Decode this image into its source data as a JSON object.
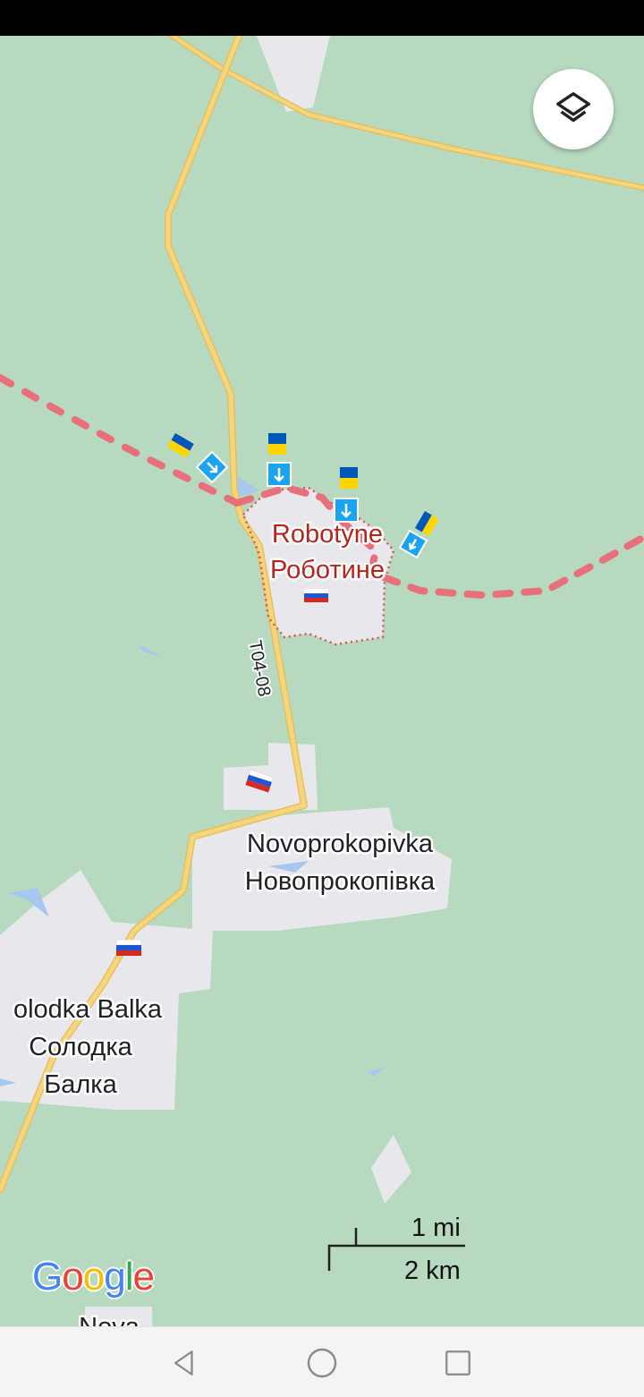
{
  "map": {
    "places": [
      {
        "id": "robotyne",
        "name_en": "Robotyne",
        "name_uk": "Роботине",
        "color": "#b3261e"
      },
      {
        "id": "novoprokopivka",
        "name_en": "Novoprokopivka",
        "name_uk": "Новопрокопівка",
        "color": "#202124"
      },
      {
        "id": "solodka-balka",
        "name_en": "olodka Balka",
        "name_uk_1": "Солодка",
        "name_uk_2": "Балка",
        "color": "#202124"
      },
      {
        "id": "nova-partial",
        "name": "Nova"
      }
    ],
    "road_label": "T04-08",
    "markers": {
      "ukraine_flag_icon": "ukraine-flag",
      "russia_flag_icon": "russia-flag",
      "advance_arrow_icon": "arrow-advance"
    },
    "colors": {
      "land": "#b7d9c0",
      "settlement": "#e8e8ec",
      "road": "#f7d57b",
      "frontline": "#e8707a",
      "ua_blue": "#0057b7",
      "ua_yellow": "#ffd500",
      "arrow_blue": "#1aa3f0"
    }
  },
  "scale": {
    "miles": "1 mi",
    "km": "2 km"
  },
  "branding": {
    "google": [
      "G",
      "o",
      "o",
      "g",
      "l",
      "e"
    ],
    "google_colors": [
      "#4285f4",
      "#ea4335",
      "#fbbc05",
      "#4285f4",
      "#34a853",
      "#ea4335"
    ]
  },
  "controls": {
    "layers_icon": "layers-icon"
  },
  "nav": {
    "back_icon": "back-icon",
    "home_icon": "home-icon",
    "recents_icon": "recents-icon"
  }
}
